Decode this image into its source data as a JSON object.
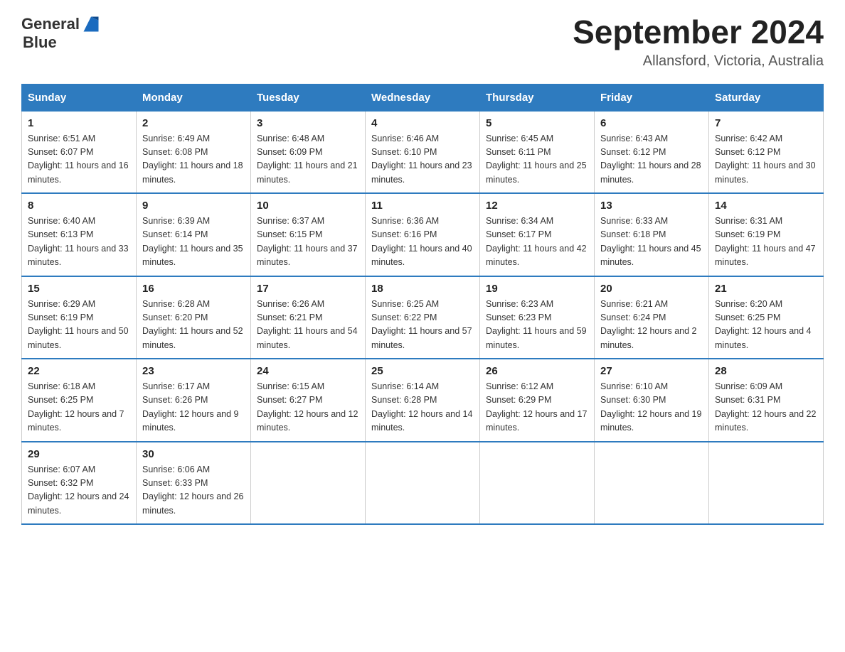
{
  "header": {
    "logo_general": "General",
    "logo_blue": "Blue",
    "month_year": "September 2024",
    "location": "Allansford, Victoria, Australia"
  },
  "days_of_week": [
    "Sunday",
    "Monday",
    "Tuesday",
    "Wednesday",
    "Thursday",
    "Friday",
    "Saturday"
  ],
  "weeks": [
    [
      {
        "day": "1",
        "sunrise": "6:51 AM",
        "sunset": "6:07 PM",
        "daylight": "11 hours and 16 minutes."
      },
      {
        "day": "2",
        "sunrise": "6:49 AM",
        "sunset": "6:08 PM",
        "daylight": "11 hours and 18 minutes."
      },
      {
        "day": "3",
        "sunrise": "6:48 AM",
        "sunset": "6:09 PM",
        "daylight": "11 hours and 21 minutes."
      },
      {
        "day": "4",
        "sunrise": "6:46 AM",
        "sunset": "6:10 PM",
        "daylight": "11 hours and 23 minutes."
      },
      {
        "day": "5",
        "sunrise": "6:45 AM",
        "sunset": "6:11 PM",
        "daylight": "11 hours and 25 minutes."
      },
      {
        "day": "6",
        "sunrise": "6:43 AM",
        "sunset": "6:12 PM",
        "daylight": "11 hours and 28 minutes."
      },
      {
        "day": "7",
        "sunrise": "6:42 AM",
        "sunset": "6:12 PM",
        "daylight": "11 hours and 30 minutes."
      }
    ],
    [
      {
        "day": "8",
        "sunrise": "6:40 AM",
        "sunset": "6:13 PM",
        "daylight": "11 hours and 33 minutes."
      },
      {
        "day": "9",
        "sunrise": "6:39 AM",
        "sunset": "6:14 PM",
        "daylight": "11 hours and 35 minutes."
      },
      {
        "day": "10",
        "sunrise": "6:37 AM",
        "sunset": "6:15 PM",
        "daylight": "11 hours and 37 minutes."
      },
      {
        "day": "11",
        "sunrise": "6:36 AM",
        "sunset": "6:16 PM",
        "daylight": "11 hours and 40 minutes."
      },
      {
        "day": "12",
        "sunrise": "6:34 AM",
        "sunset": "6:17 PM",
        "daylight": "11 hours and 42 minutes."
      },
      {
        "day": "13",
        "sunrise": "6:33 AM",
        "sunset": "6:18 PM",
        "daylight": "11 hours and 45 minutes."
      },
      {
        "day": "14",
        "sunrise": "6:31 AM",
        "sunset": "6:19 PM",
        "daylight": "11 hours and 47 minutes."
      }
    ],
    [
      {
        "day": "15",
        "sunrise": "6:29 AM",
        "sunset": "6:19 PM",
        "daylight": "11 hours and 50 minutes."
      },
      {
        "day": "16",
        "sunrise": "6:28 AM",
        "sunset": "6:20 PM",
        "daylight": "11 hours and 52 minutes."
      },
      {
        "day": "17",
        "sunrise": "6:26 AM",
        "sunset": "6:21 PM",
        "daylight": "11 hours and 54 minutes."
      },
      {
        "day": "18",
        "sunrise": "6:25 AM",
        "sunset": "6:22 PM",
        "daylight": "11 hours and 57 minutes."
      },
      {
        "day": "19",
        "sunrise": "6:23 AM",
        "sunset": "6:23 PM",
        "daylight": "11 hours and 59 minutes."
      },
      {
        "day": "20",
        "sunrise": "6:21 AM",
        "sunset": "6:24 PM",
        "daylight": "12 hours and 2 minutes."
      },
      {
        "day": "21",
        "sunrise": "6:20 AM",
        "sunset": "6:25 PM",
        "daylight": "12 hours and 4 minutes."
      }
    ],
    [
      {
        "day": "22",
        "sunrise": "6:18 AM",
        "sunset": "6:25 PM",
        "daylight": "12 hours and 7 minutes."
      },
      {
        "day": "23",
        "sunrise": "6:17 AM",
        "sunset": "6:26 PM",
        "daylight": "12 hours and 9 minutes."
      },
      {
        "day": "24",
        "sunrise": "6:15 AM",
        "sunset": "6:27 PM",
        "daylight": "12 hours and 12 minutes."
      },
      {
        "day": "25",
        "sunrise": "6:14 AM",
        "sunset": "6:28 PM",
        "daylight": "12 hours and 14 minutes."
      },
      {
        "day": "26",
        "sunrise": "6:12 AM",
        "sunset": "6:29 PM",
        "daylight": "12 hours and 17 minutes."
      },
      {
        "day": "27",
        "sunrise": "6:10 AM",
        "sunset": "6:30 PM",
        "daylight": "12 hours and 19 minutes."
      },
      {
        "day": "28",
        "sunrise": "6:09 AM",
        "sunset": "6:31 PM",
        "daylight": "12 hours and 22 minutes."
      }
    ],
    [
      {
        "day": "29",
        "sunrise": "6:07 AM",
        "sunset": "6:32 PM",
        "daylight": "12 hours and 24 minutes."
      },
      {
        "day": "30",
        "sunrise": "6:06 AM",
        "sunset": "6:33 PM",
        "daylight": "12 hours and 26 minutes."
      },
      null,
      null,
      null,
      null,
      null
    ]
  ],
  "labels": {
    "sunrise": "Sunrise:",
    "sunset": "Sunset:",
    "daylight": "Daylight:"
  }
}
